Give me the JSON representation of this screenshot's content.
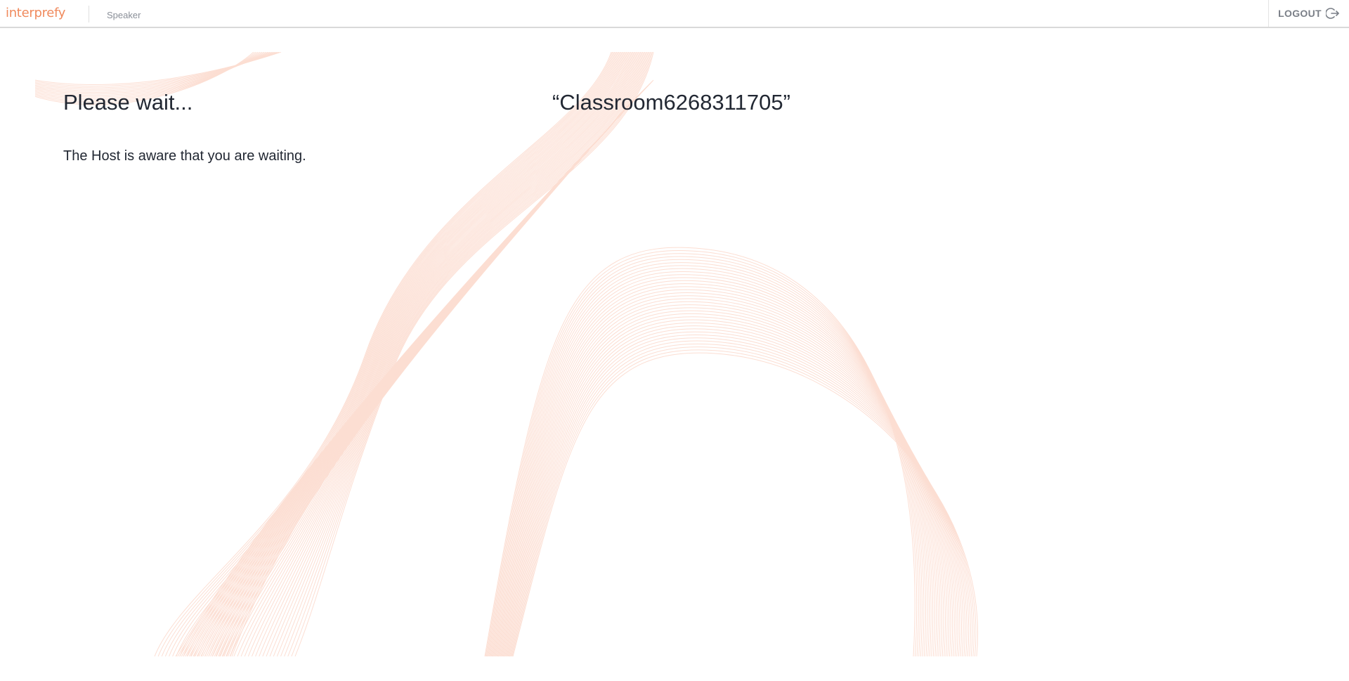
{
  "header": {
    "logo_text": "interprefy",
    "role": "Speaker",
    "logout_label": "LOGOUT",
    "logout_icon": "logout-icon"
  },
  "main": {
    "title": "Please wait...",
    "room_name": "“Classroom6268311705”",
    "message": "The Host is aware that you are waiting."
  },
  "colors": {
    "brand": "#f08a5d",
    "text": "#222833",
    "background_art": "#fbd3c4"
  }
}
